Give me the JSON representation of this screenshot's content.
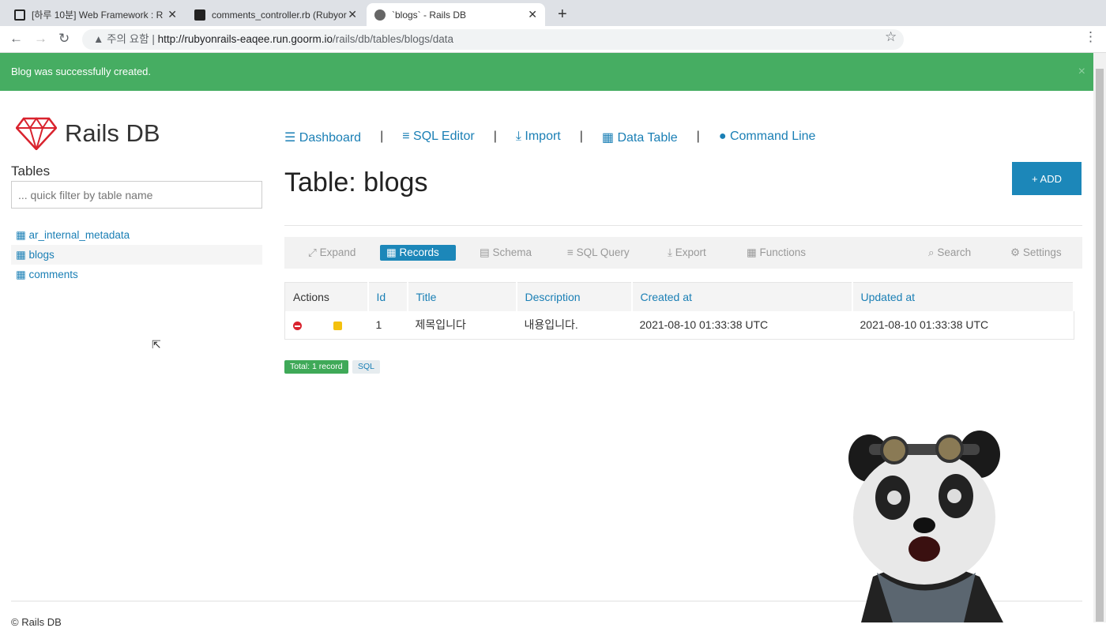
{
  "browser": {
    "tabs": [
      {
        "title": "[하루 10분] Web Framework : R",
        "icon": "notion-icon"
      },
      {
        "title": "comments_controller.rb (Rubyor",
        "icon": "terminal-icon"
      },
      {
        "title": "`blogs` - Rails DB",
        "icon": "globe-icon",
        "active": true
      }
    ],
    "security_label": "주의 요함",
    "url_host": "http://rubyonrails-eaqee.run.goorm.io",
    "url_path": "/rails/db/tables/blogs/data"
  },
  "alert": {
    "message": "Blog was successfully created.",
    "close": "×"
  },
  "brand": {
    "name": "Rails DB",
    "accent": "#d9232e"
  },
  "sidebar": {
    "heading": "Tables",
    "filter_placeholder": "... quick filter by table name",
    "tables": [
      {
        "name": "ar_internal_metadata"
      },
      {
        "name": "blogs",
        "selected": true
      },
      {
        "name": "comments"
      }
    ]
  },
  "topnav": {
    "items": [
      {
        "label": "Dashboard",
        "icon": "list-icon"
      },
      {
        "label": "SQL Editor",
        "icon": "database-icon"
      },
      {
        "label": "Import",
        "icon": "download-icon"
      },
      {
        "label": "Data Table",
        "icon": "table-icon"
      },
      {
        "label": "Command Line",
        "icon": "circle-icon"
      }
    ],
    "separator": "|"
  },
  "page": {
    "title": "Table: blogs",
    "add_label": "+ ADD"
  },
  "toolbar": {
    "items": [
      {
        "label": "Expand",
        "icon": "expand-icon"
      },
      {
        "label": "Records",
        "icon": "table-icon",
        "active": true
      },
      {
        "label": "Schema",
        "icon": "schema-icon"
      },
      {
        "label": "SQL Query",
        "icon": "database-icon"
      },
      {
        "label": "Export",
        "icon": "download-icon"
      },
      {
        "label": "Functions",
        "icon": "grid-icon"
      },
      {
        "label": "Search",
        "icon": "search-icon"
      },
      {
        "label": "Settings",
        "icon": "gears-icon"
      }
    ]
  },
  "table": {
    "columns": [
      "Actions",
      "Id",
      "Title",
      "Description",
      "Created at",
      "Updated at"
    ],
    "rows": [
      {
        "id": "1",
        "title": "제목입니다",
        "description": "내용입니다.",
        "created_at": "2021-08-10 01:33:38 UTC",
        "updated_at": "2021-08-10 01:33:38 UTC"
      }
    ]
  },
  "summary": {
    "total": "Total: 1 record",
    "sql": "SQL"
  },
  "footer": {
    "text": "© Rails DB"
  }
}
